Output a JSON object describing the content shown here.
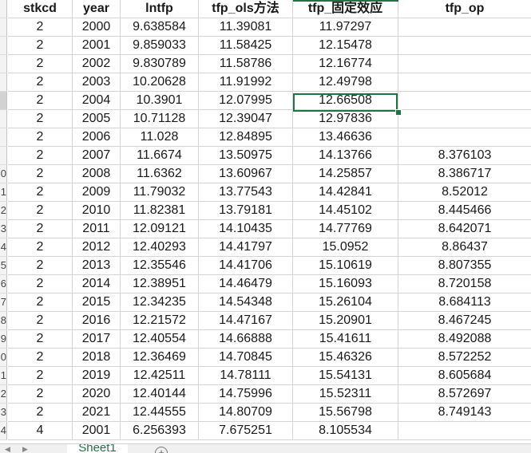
{
  "sheet": {
    "headers": [
      "stkcd",
      "year",
      "lntfp",
      "tfp_ols方法",
      "tfp_固定效应",
      "tfp_op"
    ],
    "row_numbers": [
      "",
      "",
      "",
      "",
      "",
      "",
      "",
      "",
      "",
      "0",
      "1",
      "2",
      "3",
      "4",
      "5",
      "6",
      "7",
      "8",
      "9",
      "0",
      "1",
      "2",
      "3",
      "4"
    ],
    "rows": [
      [
        "2",
        "2000",
        "9.638584",
        "11.39081",
        "11.97297",
        ""
      ],
      [
        "2",
        "2001",
        "9.859033",
        "11.58425",
        "12.15478",
        ""
      ],
      [
        "2",
        "2002",
        "9.830789",
        "11.58786",
        "12.16774",
        ""
      ],
      [
        "2",
        "2003",
        "10.20628",
        "11.91992",
        "12.49798",
        ""
      ],
      [
        "2",
        "2004",
        "10.3901",
        "12.07995",
        "12.66508",
        ""
      ],
      [
        "2",
        "2005",
        "10.71128",
        "12.39047",
        "12.97836",
        ""
      ],
      [
        "2",
        "2006",
        "11.028",
        "12.84895",
        "13.46636",
        ""
      ],
      [
        "2",
        "2007",
        "11.6674",
        "13.50975",
        "14.13766",
        "8.376103"
      ],
      [
        "2",
        "2008",
        "11.6362",
        "13.60967",
        "14.25857",
        "8.386717"
      ],
      [
        "2",
        "2009",
        "11.79032",
        "13.77543",
        "14.42841",
        "8.52012"
      ],
      [
        "2",
        "2010",
        "11.82381",
        "13.79181",
        "14.45102",
        "8.445466"
      ],
      [
        "2",
        "2011",
        "12.09121",
        "14.10435",
        "14.77769",
        "8.642071"
      ],
      [
        "2",
        "2012",
        "12.40293",
        "14.41797",
        "15.0952",
        "8.86437"
      ],
      [
        "2",
        "2013",
        "12.35546",
        "14.41706",
        "15.10619",
        "8.807355"
      ],
      [
        "2",
        "2014",
        "12.38951",
        "14.46479",
        "15.16093",
        "8.720158"
      ],
      [
        "2",
        "2015",
        "12.34235",
        "14.54348",
        "15.26104",
        "8.684113"
      ],
      [
        "2",
        "2016",
        "12.21572",
        "14.47167",
        "15.20901",
        "8.467245"
      ],
      [
        "2",
        "2017",
        "12.40554",
        "14.66888",
        "15.41611",
        "8.492088"
      ],
      [
        "2",
        "2018",
        "12.36469",
        "14.70845",
        "15.46326",
        "8.572252"
      ],
      [
        "2",
        "2019",
        "12.42511",
        "14.78111",
        "15.54131",
        "8.605684"
      ],
      [
        "2",
        "2020",
        "12.40144",
        "14.75996",
        "15.52311",
        "8.572697"
      ],
      [
        "2",
        "2021",
        "12.44555",
        "14.80709",
        "15.56798",
        "8.749143"
      ],
      [
        "4",
        "2001",
        "6.256393",
        "7.675251",
        "8.105534",
        ""
      ]
    ],
    "selected_cell": "12.66508"
  },
  "tabs": {
    "active_sheet": "Sheet1",
    "add_label": "+"
  },
  "colors": {
    "accent": "#217346",
    "gridline": "#d4d4d4"
  }
}
